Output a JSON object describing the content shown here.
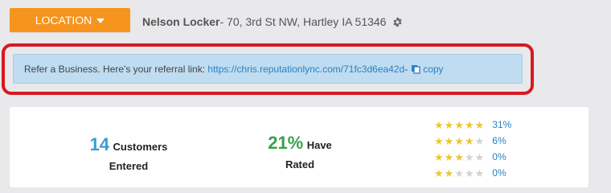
{
  "header": {
    "location_label": "LOCATION",
    "business_name": "Nelson Locker",
    "business_address": " - 70, 3rd St NW, Hartley IA 51346"
  },
  "referral": {
    "prefix": "Refer a Business. Here's your referral link: ",
    "link": "https://chris.reputationlync.com/71fc3d6ea42d",
    "separator": " - ",
    "copy_label": "copy"
  },
  "stats": {
    "customers_value": "14",
    "customers_label": "Customers",
    "customers_label2": "Entered",
    "rated_value": "21%",
    "rated_label": "Have",
    "rated_label2": "Rated"
  },
  "ratings": [
    {
      "stars": 5,
      "percent": "31%"
    },
    {
      "stars": 4,
      "percent": "6%"
    },
    {
      "stars": 3,
      "percent": "0%"
    },
    {
      "stars": 2,
      "percent": "0%"
    }
  ],
  "colors": {
    "accent_orange": "#f7941d",
    "highlight_red": "#d71920",
    "link_blue": "#2a7fc1",
    "customers_blue": "#3a9bd9",
    "rated_green": "#3aa04a",
    "star_gold": "#e7c83a"
  }
}
